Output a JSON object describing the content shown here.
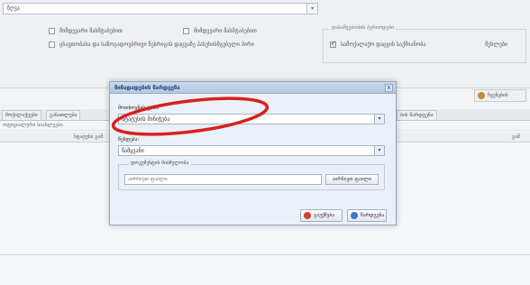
{
  "top": {
    "combo_value": "ზღვა",
    "checkbox1_label": "მიმდევარი მასშტაბებით",
    "checkbox2_label": "მიმდევარი მასშტაბებით",
    "checkbox3_label": "ცხავთობასა და საზოგადოებრივი წესრიგის დაცვაზე პასუხისმგებელი პირი",
    "fieldset_legend": "დასაშვებობის პერიოდები",
    "fieldset_checkbox_label": "სამოქალაქო დაცვის საქმიანობა",
    "fieldset_extra": "მუხლები"
  },
  "right_button_label": "ჩვენების",
  "tabs": [
    "მოქალაქეები",
    "განათლება",
    "ბის წარდგენა"
  ],
  "list_header": "ოფიციალური სიახლეები",
  "grid_headers": [
    "სტატუსი გამ.",
    "გამ"
  ],
  "modal": {
    "title": "წინადადების წარდგენა",
    "close_label": "x",
    "field1_label": "მოთხოვნის ტიპი:",
    "field1_value": "სტატუსის მინიჭება",
    "field2_label": "წესდება:",
    "field2_value": "წამყვანი",
    "group_legend": "დოკუმენტის მიბმულობა",
    "file_placeholder": "აირჩიეთ ფაილი",
    "file_button_label": "აირჩიეთ ფაილი",
    "cancel_label": "გაუქმება",
    "submit_label": "წარდგენა"
  },
  "colors": {
    "annotation": "#d8201c",
    "cancel_icon": "#d93a2b",
    "submit_icon": "#3a78c8"
  }
}
